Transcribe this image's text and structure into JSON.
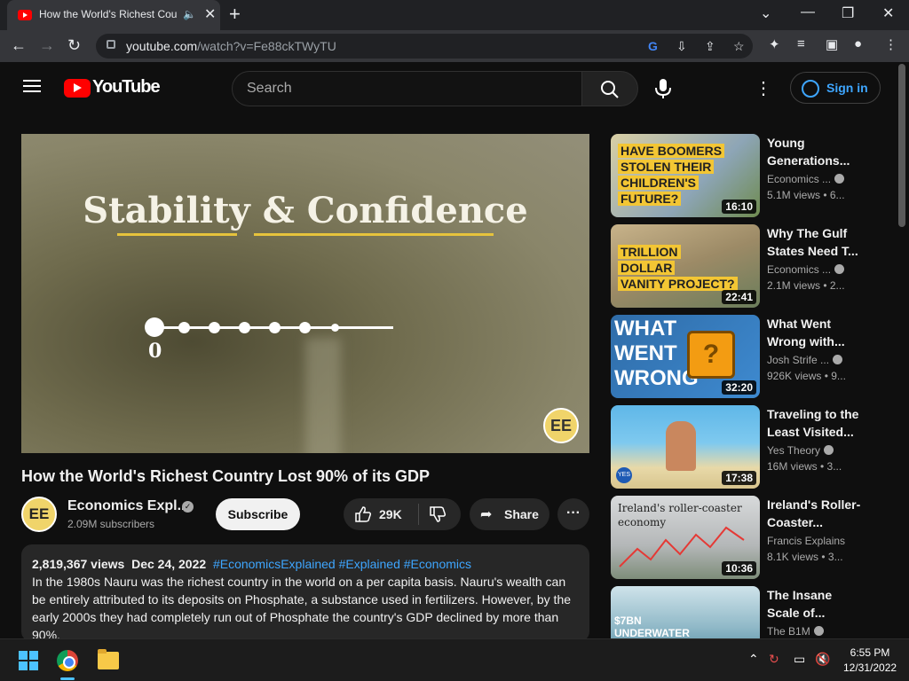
{
  "browser": {
    "tab_title": "How the World's Richest Cou",
    "tab_audio_icon": "speaker-icon",
    "url_domain": "youtube.com",
    "url_path": "/watch?v=Fe88ckTWyTU",
    "new_tab": "+",
    "win_min": "—",
    "win_restore": "❐",
    "win_close": "✕",
    "tab_list": "⌄"
  },
  "header": {
    "logo_text": "YouTube",
    "search_placeholder": "Search",
    "sign_in": "Sign in"
  },
  "player": {
    "slide_title": "Stability & Confidence",
    "timeline_start": "0",
    "badge": "EE"
  },
  "video": {
    "title": "How the World's Richest Country Lost 90% of its GDP",
    "channel": "Economics Expl...",
    "subscribers": "2.09M subscribers",
    "subscribe": "Subscribe",
    "likes": "29K",
    "share": "Share",
    "avatar": "EE"
  },
  "description": {
    "views": "2,819,367 views",
    "date": "Dec 24, 2022",
    "hashtags": "#EconomicsExplained #Explained #Economics",
    "text": "In the 1980s Nauru was the richest country in the world on a per capita basis. Nauru's wealth can be entirely attributed to its deposits on Phosphate, a substance used in fertilizers. However, by the early 2000s they had completely run out of Phosphate the country's GDP declined by more than 90%."
  },
  "recommendations": [
    {
      "title": "Young Generations...",
      "channel": "Economics ...",
      "views": "5.1M views • 6...",
      "duration": "16:10",
      "thumb_text": [
        "HAVE BOOMERS",
        "STOLEN THEIR",
        "CHILDREN'S",
        "FUTURE?"
      ]
    },
    {
      "title": "Why The Gulf States Need T...",
      "channel": "Economics ...",
      "views": "2.1M views • 2...",
      "duration": "22:41",
      "thumb_text": [
        "TRILLION",
        "DOLLAR",
        "VANITY PROJECT?"
      ]
    },
    {
      "title": "What Went Wrong with...",
      "channel": "Josh Strife ...",
      "views": "926K views • 9...",
      "duration": "32:20",
      "thumb_text": [
        "WHAT",
        "WENT",
        "WRONG"
      ]
    },
    {
      "title": "Traveling to the Least Visited...",
      "channel": "Yes Theory",
      "views": "16M views • 3...",
      "duration": "17:38",
      "thumb_text": []
    },
    {
      "title": "Ireland's Roller-Coaster...",
      "channel": "Francis Explains",
      "views": "8.1K views • 3...",
      "duration": "10:36",
      "thumb_text": [
        "Ireland's roller-coaster",
        "economy"
      ]
    },
    {
      "title": "The Insane Scale of...",
      "channel": "The B1M",
      "views": "",
      "duration": "",
      "thumb_text": [
        "$7BN",
        "UNDERWATER"
      ]
    }
  ],
  "taskbar": {
    "time": "6:55 PM",
    "date": "12/31/2022"
  }
}
